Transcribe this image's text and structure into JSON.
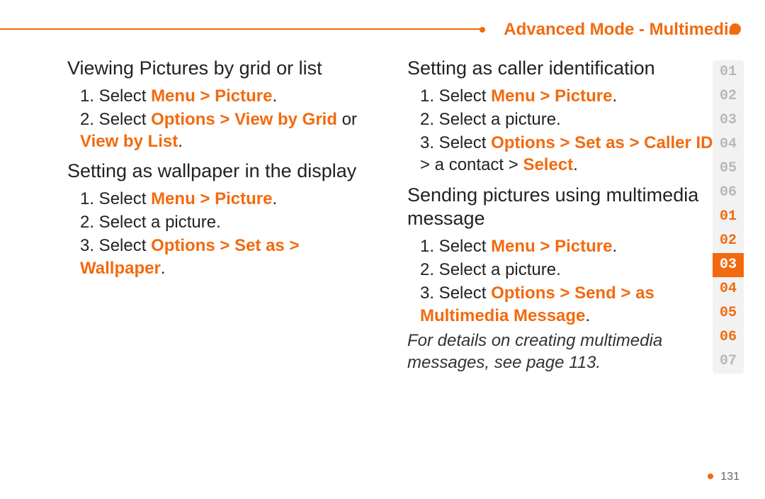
{
  "header": {
    "title": "Advanced Mode - Multimedia"
  },
  "pageNumber": "131",
  "sideIndex": [
    {
      "n": "01",
      "cls": "grey"
    },
    {
      "n": "02",
      "cls": "grey"
    },
    {
      "n": "03",
      "cls": "grey"
    },
    {
      "n": "04",
      "cls": "grey"
    },
    {
      "n": "05",
      "cls": "grey"
    },
    {
      "n": "06",
      "cls": "grey"
    },
    {
      "n": "01",
      "cls": "orange"
    },
    {
      "n": "02",
      "cls": "orange"
    },
    {
      "n": "03",
      "cls": "active"
    },
    {
      "n": "04",
      "cls": "orange"
    },
    {
      "n": "05",
      "cls": "orange"
    },
    {
      "n": "06",
      "cls": "orange"
    },
    {
      "n": "07",
      "cls": "grey"
    }
  ],
  "left": {
    "sec1": {
      "title": "Viewing Pictures by grid or list",
      "step1_a": "1. Select ",
      "step1_b": "Menu > Picture",
      "step1_c": ".",
      "step2_a": "2. Select ",
      "step2_b": "Options > View by Grid",
      "step2_c": " or ",
      "step2_d": "View by List",
      "step2_e": "."
    },
    "sec2": {
      "title": "Setting as wallpaper in the display",
      "step1_a": "1. Select ",
      "step1_b": "Menu > Picture",
      "step1_c": ".",
      "step2": "2. Select a picture.",
      "step3_a": "3. Select ",
      "step3_b": "Options > Set as > Wallpaper",
      "step3_c": "."
    }
  },
  "right": {
    "sec1": {
      "title": "Setting as caller identification",
      "step1_a": "1. Select ",
      "step1_b": "Menu > Picture",
      "step1_c": ".",
      "step2": "2. Select a picture.",
      "step3_a": "3. Select ",
      "step3_b": "Options > Set as > Caller ID",
      "step3_c": " > a contact > ",
      "step3_d": "Select",
      "step3_e": "."
    },
    "sec2": {
      "title": "Sending pictures using multimedia message",
      "step1_a": "1. Select ",
      "step1_b": "Menu > Picture",
      "step1_c": ".",
      "step2": "2. Select a picture.",
      "step3_a": "3. Select ",
      "step3_b": "Options > Send > as Multimedia Message",
      "step3_c": ".",
      "note": "For details on creating multimedia messages, see page 113."
    }
  }
}
